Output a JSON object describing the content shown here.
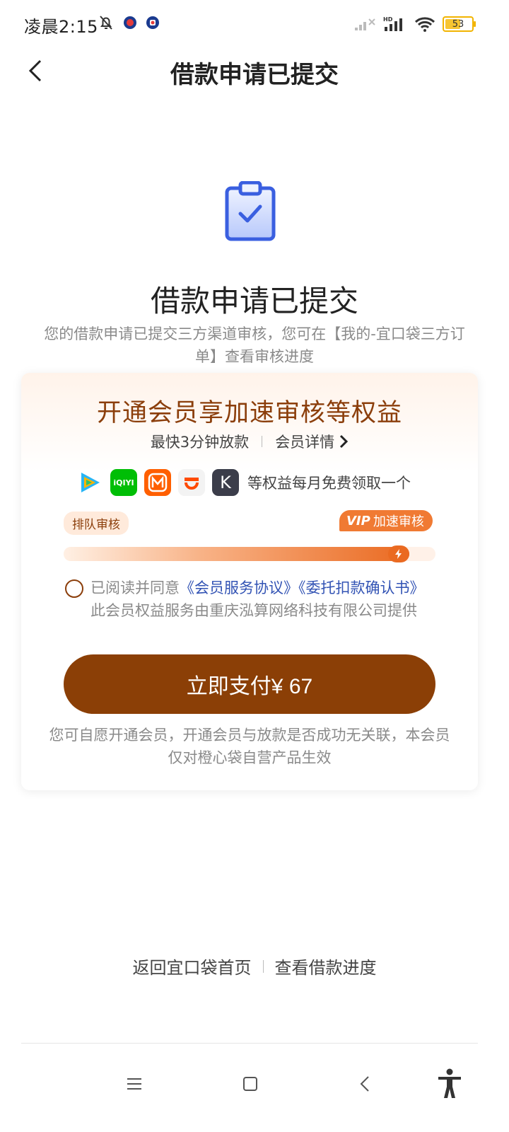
{
  "status_bar": {
    "time": "凌晨2:15",
    "battery": "53",
    "network": "HD"
  },
  "header": {
    "title": "借款申请已提交"
  },
  "hero": {
    "title": "借款申请已提交",
    "description": "您的借款申请已提交三方渠道审核，您可在【我的-宜口袋三方订单】查看审核进度"
  },
  "card": {
    "title": "开通会员享加速审核等权益",
    "subtitle_left": "最快3分钟放款",
    "subtitle_right": "会员详情",
    "apps": [
      {
        "name": "tencent-video-icon",
        "color": "#2ec26a"
      },
      {
        "name": "iqiyi-icon",
        "color": "#00be06",
        "label": "iQIYI"
      },
      {
        "name": "mgtv-icon",
        "color": "#ff5f00"
      },
      {
        "name": "youku-like-icon",
        "color": "#ff4a00"
      },
      {
        "name": "k-app-icon",
        "color": "#3b3d4a",
        "label": "K"
      }
    ],
    "apps_text": "等权益每月免费领取一个",
    "queue_label": "排队审核",
    "vip_label_italic": "VIP",
    "vip_label": "加速审核",
    "progress": 0.93,
    "agreement": {
      "prefix": "已阅读并同意",
      "link1": "《会员服务协议》",
      "link2": "《委托扣款确认书》",
      "suffix": "此会员权益服务由重庆泓算网络科技有限公司提供"
    },
    "pay_button": "立即支付¥ 67",
    "note": "您可自愿开通会员，开通会员与放款是否成功无关联，本会员仅对橙心袋自营产品生效"
  },
  "bottom_links": {
    "home": "返回宜口袋首页",
    "progress": "查看借款进度"
  },
  "colors": {
    "brand_brown": "#8b3f06",
    "accent_orange": "#ea6a21",
    "link_blue": "#3253b4",
    "icon_blue": "#3a5fe0"
  }
}
